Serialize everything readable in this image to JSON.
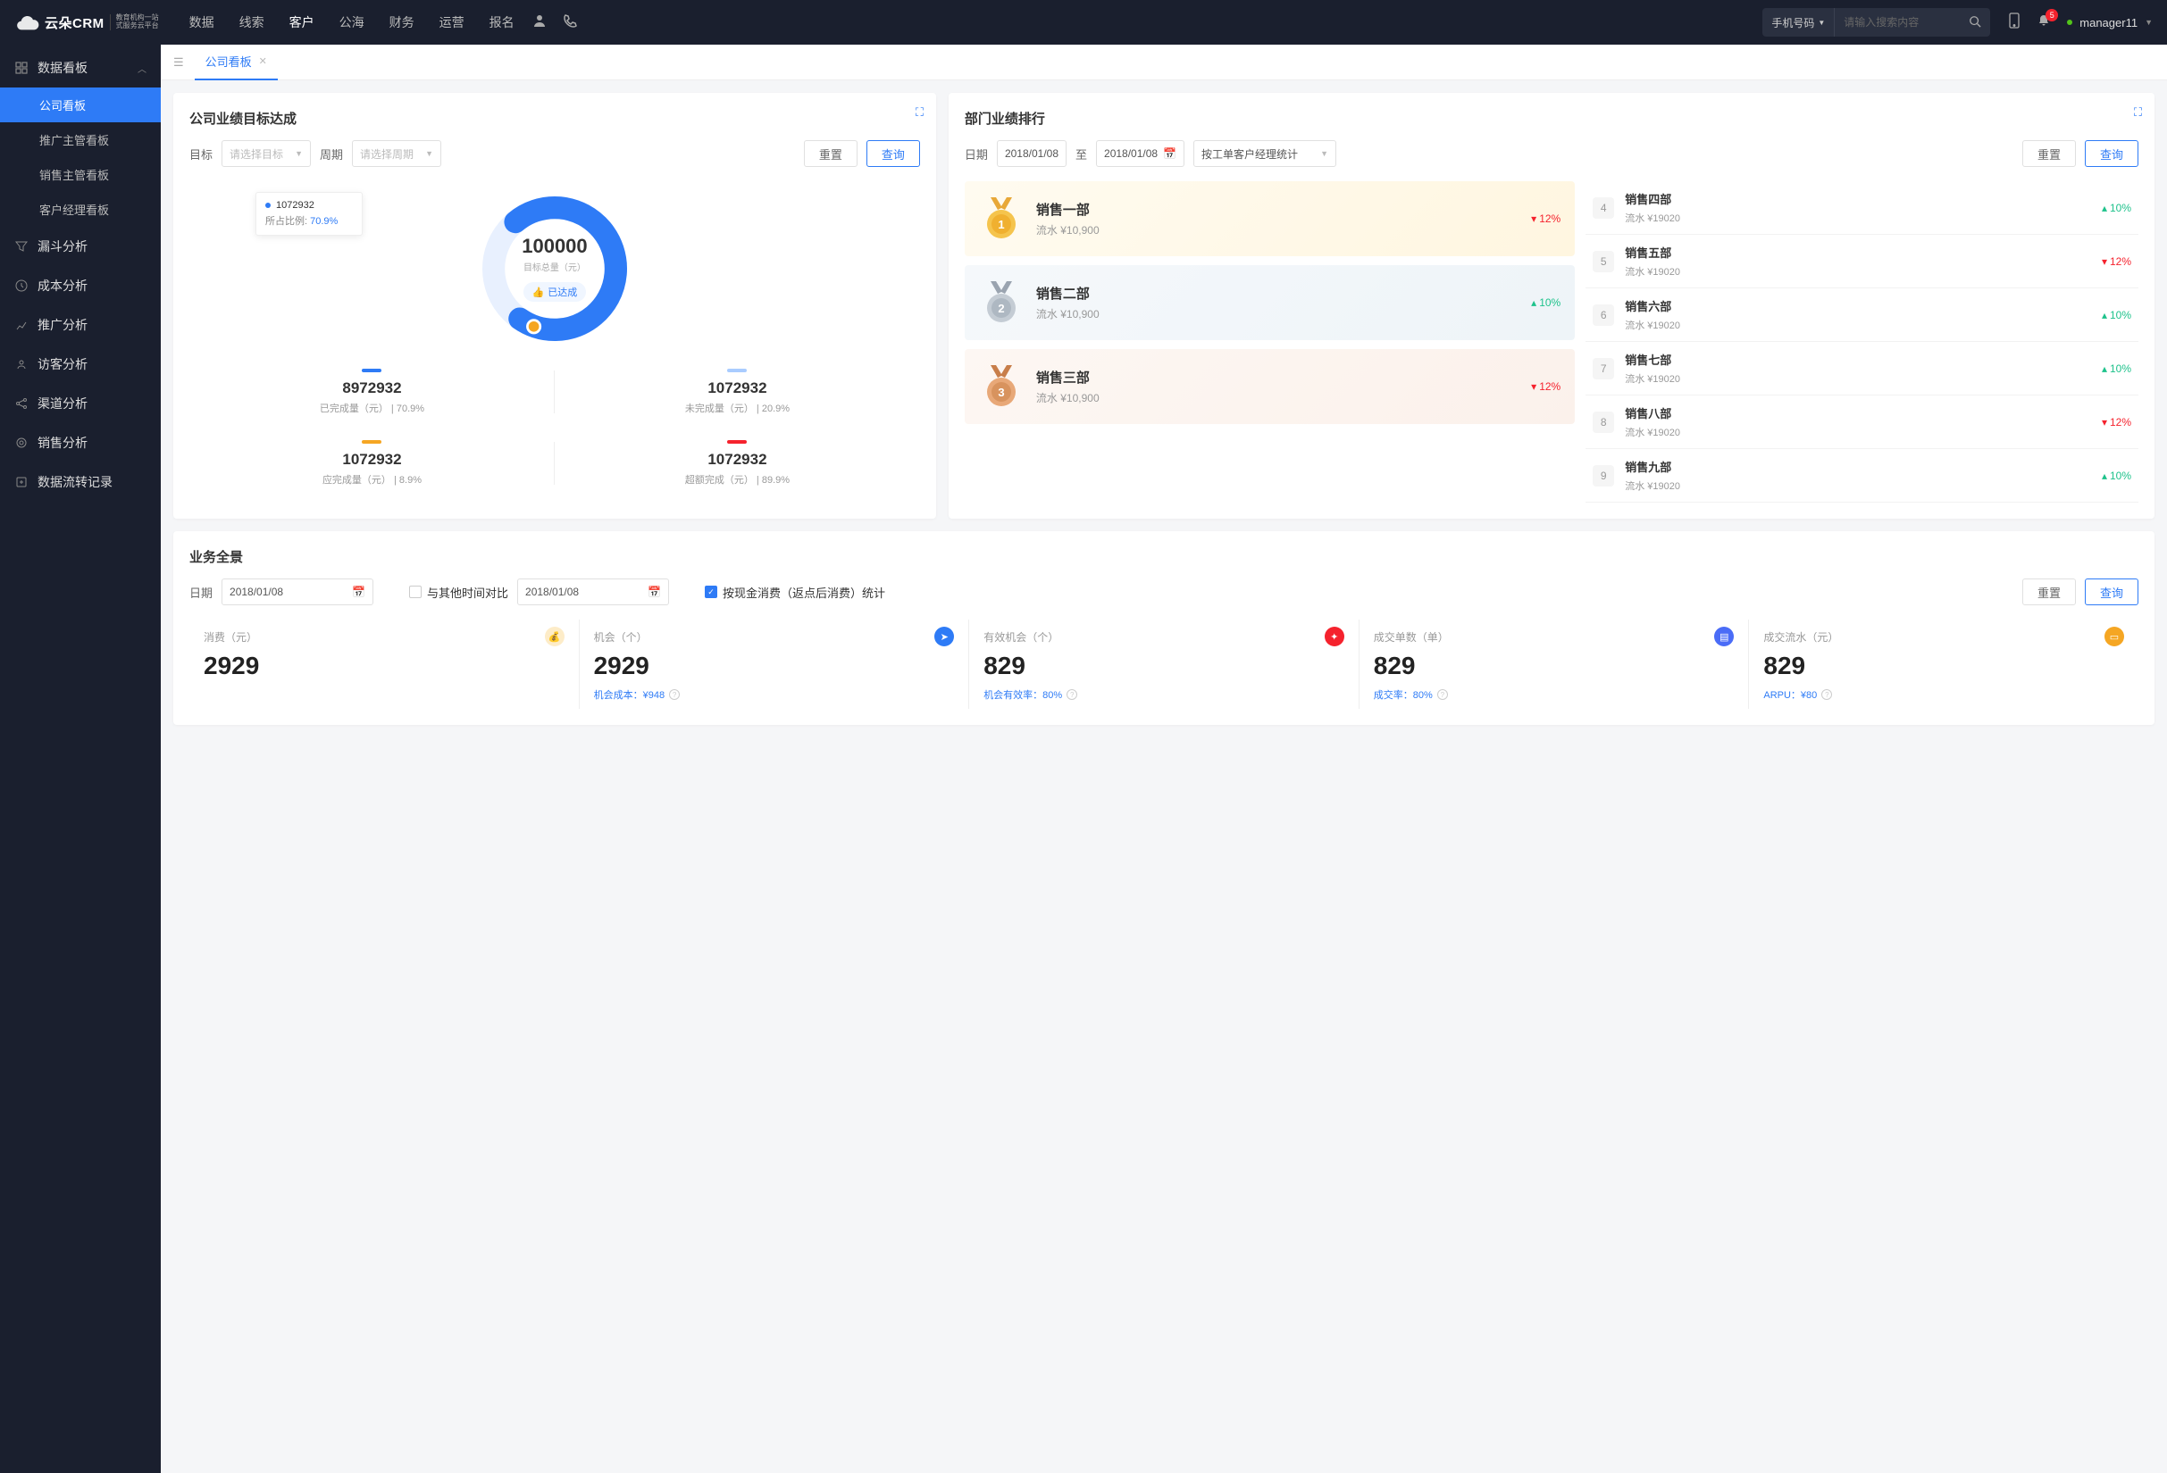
{
  "brand": {
    "name": "云朵CRM",
    "sub1": "教育机构一站",
    "sub2": "式服务云平台"
  },
  "topnav": {
    "items": [
      "数据",
      "线索",
      "客户",
      "公海",
      "财务",
      "运营",
      "报名"
    ],
    "active_index": 2,
    "search_type": "手机号码",
    "search_placeholder": "请输入搜索内容",
    "badge": "5",
    "user": "manager11"
  },
  "sidebar": {
    "group_label": "数据看板",
    "children": [
      "公司看板",
      "推广主管看板",
      "销售主管看板",
      "客户经理看板"
    ],
    "active_child": 0,
    "items": [
      "漏斗分析",
      "成本分析",
      "推广分析",
      "访客分析",
      "渠道分析",
      "销售分析",
      "数据流转记录"
    ]
  },
  "tabs": {
    "label": "公司看板"
  },
  "target_card": {
    "title": "公司业绩目标达成",
    "filter_target_label": "目标",
    "filter_target_placeholder": "请选择目标",
    "filter_period_label": "周期",
    "filter_period_placeholder": "请选择周期",
    "reset": "重置",
    "query": "查询",
    "tooltip_value": "1072932",
    "tooltip_ratio_label": "所占比例:",
    "tooltip_ratio_value": "70.9%",
    "center_value": "100000",
    "center_label": "目标总量（元）",
    "badge": "已达成",
    "stats": [
      {
        "color": "#2e7bf6",
        "value": "8972932",
        "label": "已完成量（元）",
        "pct": "70.9%"
      },
      {
        "color": "#a9ccff",
        "value": "1072932",
        "label": "未完成量（元）",
        "pct": "20.9%"
      },
      {
        "color": "#f5a623",
        "value": "1072932",
        "label": "应完成量（元）",
        "pct": "8.9%"
      },
      {
        "color": "#f5222d",
        "value": "1072932",
        "label": "超额完成（元）",
        "pct": "89.9%"
      }
    ]
  },
  "rank_card": {
    "title": "部门业绩排行",
    "date_label": "日期",
    "date1": "2018/01/08",
    "date_to": "至",
    "date2": "2018/01/08",
    "group_by": "按工单客户经理统计",
    "reset": "重置",
    "query": "查询",
    "top3": [
      {
        "name": "销售一部",
        "sub": "流水 ¥10,900",
        "pct": "12%",
        "dir": "down"
      },
      {
        "name": "销售二部",
        "sub": "流水 ¥10,900",
        "pct": "10%",
        "dir": "up"
      },
      {
        "name": "销售三部",
        "sub": "流水 ¥10,900",
        "pct": "12%",
        "dir": "down"
      }
    ],
    "rest": [
      {
        "n": "4",
        "name": "销售四部",
        "sub": "流水 ¥19020",
        "pct": "10%",
        "dir": "up"
      },
      {
        "n": "5",
        "name": "销售五部",
        "sub": "流水 ¥19020",
        "pct": "12%",
        "dir": "down"
      },
      {
        "n": "6",
        "name": "销售六部",
        "sub": "流水 ¥19020",
        "pct": "10%",
        "dir": "up"
      },
      {
        "n": "7",
        "name": "销售七部",
        "sub": "流水 ¥19020",
        "pct": "10%",
        "dir": "up"
      },
      {
        "n": "8",
        "name": "销售八部",
        "sub": "流水 ¥19020",
        "pct": "12%",
        "dir": "down"
      },
      {
        "n": "9",
        "name": "销售九部",
        "sub": "流水 ¥19020",
        "pct": "10%",
        "dir": "up"
      }
    ]
  },
  "overview": {
    "title": "业务全景",
    "date_label": "日期",
    "date1": "2018/01/08",
    "compare_label": "与其他时间对比",
    "date2": "2018/01/08",
    "stat_label": "按现金消费（返点后消费）统计",
    "reset": "重置",
    "query": "查询",
    "cells": [
      {
        "label": "消费（元）",
        "value": "2929",
        "sub": "",
        "icon_bg": "#f5a623"
      },
      {
        "label": "机会（个）",
        "value": "2929",
        "sub": "机会成本：¥948",
        "icon_bg": "#2e7bf6"
      },
      {
        "label": "有效机会（个）",
        "value": "829",
        "sub": "机会有效率：80%",
        "icon_bg": "#f5222d"
      },
      {
        "label": "成交单数（单）",
        "value": "829",
        "sub": "成交率：80%",
        "icon_bg": "#4a6cf7"
      },
      {
        "label": "成交流水（元）",
        "value": "829",
        "sub": "ARPU：¥80",
        "icon_bg": "#f5a623"
      }
    ]
  },
  "chart_data": {
    "type": "pie",
    "title": "目标总量（元）",
    "total": 100000,
    "series": [
      {
        "name": "已完成量（元）",
        "value": 8972932,
        "pct": 70.9
      },
      {
        "name": "未完成量（元）",
        "value": 1072932,
        "pct": 20.9
      },
      {
        "name": "应完成量（元）",
        "value": 1072932,
        "pct": 8.9
      },
      {
        "name": "超额完成（元）",
        "value": 1072932,
        "pct": 89.9
      }
    ],
    "annotation": {
      "value": 1072932,
      "ratio_label": "所占比例:",
      "ratio": "70.9%"
    },
    "status": "已达成"
  }
}
